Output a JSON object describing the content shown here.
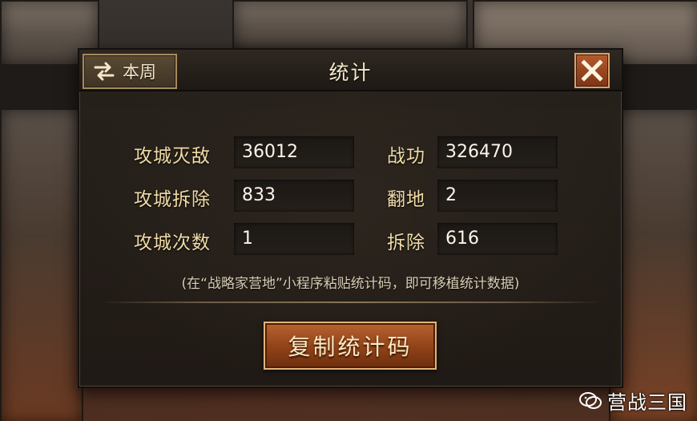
{
  "dialog": {
    "title": "统计",
    "week_button_label": "本周",
    "close_icon": "close-icon",
    "week_icon": "swap-arrows-icon"
  },
  "stats": {
    "left": [
      {
        "label": "攻城灭敌",
        "value": "36012"
      },
      {
        "label": "攻城拆除",
        "value": "833"
      },
      {
        "label": "攻城次数",
        "value": "1"
      }
    ],
    "right": [
      {
        "label": "战功",
        "value": "326470"
      },
      {
        "label": "翻地",
        "value": "2"
      },
      {
        "label": "拆除",
        "value": "616"
      }
    ]
  },
  "note": "(在“战略家营地”小程序粘贴统计码，即可移植统计数据)",
  "copy_button_label": "复制统计码",
  "watermark": {
    "text": "营战三国",
    "icon": "wechat-icon"
  },
  "colors": {
    "label_gold": "#f0dba6",
    "value_white": "#fbf5ea",
    "button_orange": "#8f4218"
  }
}
